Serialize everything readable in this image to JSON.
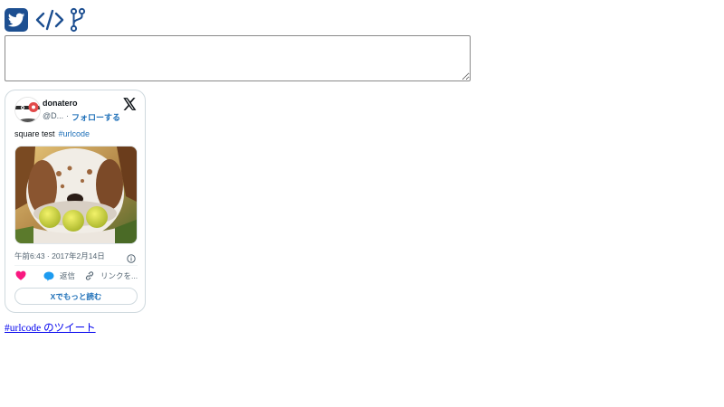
{
  "toolbar": {
    "icons": [
      "twitter-icon",
      "code-icon",
      "fork-icon"
    ],
    "accent_color": "#1d4f91"
  },
  "input": {
    "value": "",
    "placeholder": ""
  },
  "tweet": {
    "display_name": "donatero",
    "handle": "@D...",
    "separator": "·",
    "follow_label": "フォローする",
    "text": "square test",
    "hashtag": "#urlcode",
    "timestamp": "午前6:43 · 2017年2月14日",
    "actions": {
      "reply_label": "返信",
      "copy_link_label": "リンクを..."
    },
    "read_more_label": "Xでもっと読む",
    "colors": {
      "link": "#1d6fb8",
      "like": "#f91880",
      "reply": "#1d9bf0",
      "muted": "#536471"
    }
  },
  "footer_link": "#urlcode のツイート"
}
